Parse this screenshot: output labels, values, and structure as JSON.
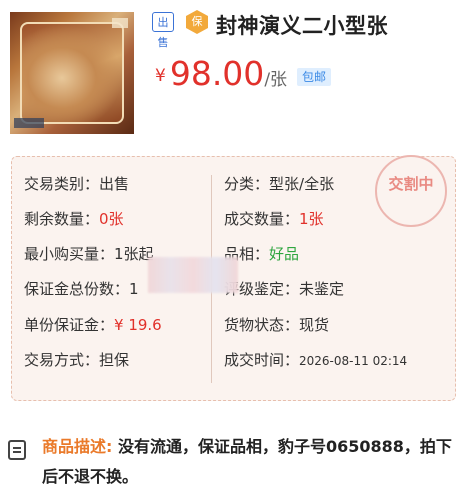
{
  "product": {
    "badge_sell": "出售",
    "badge_bao": "保",
    "title": "封神演义二小型张",
    "price_symbol": "¥",
    "price": "98.00",
    "price_unit": "/张",
    "shipping_pill": "包邮"
  },
  "details": {
    "stamp_text": "交割中",
    "left": [
      {
        "label": "交易类别：",
        "value": "出售"
      },
      {
        "label": "剩余数量：",
        "value": "0张"
      },
      {
        "label": "最小购买量：",
        "value": "1张起"
      },
      {
        "label": "保证金总份数：",
        "value": "1"
      },
      {
        "label": "单份保证金：",
        "value": "¥ 19.6"
      },
      {
        "label": "交易方式：",
        "value": "担保"
      }
    ],
    "right": [
      {
        "label": "分类：",
        "value": "型张/全张"
      },
      {
        "label": "成交数量：",
        "value": "1张"
      },
      {
        "label": "品相：",
        "value": "好品"
      },
      {
        "label": "评级鉴定：",
        "value": "未鉴定"
      },
      {
        "label": "货物状态：",
        "value": "现货"
      },
      {
        "label": "成交时间：",
        "value": "2026-08-11 02:14"
      }
    ]
  },
  "description": {
    "label": "商品描述:",
    "text": " 没有流通，保证品相，豹子号0650888，拍下后不退不换。"
  }
}
